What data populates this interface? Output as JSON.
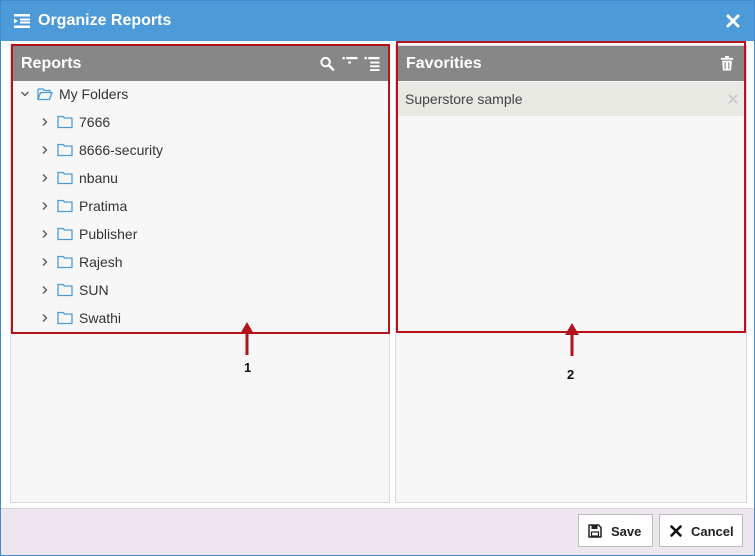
{
  "dialog": {
    "title": "Organize Reports",
    "title_icon": "list-icon",
    "close_icon": "close-icon",
    "accent_color": "#4c9ad8"
  },
  "reports_panel": {
    "title": "Reports",
    "header_icons": [
      "search-icon",
      "expand-all-icon",
      "collapse-all-icon"
    ],
    "root": {
      "label": "My Folders",
      "expanded": true
    },
    "folders": [
      "7666",
      "8666-security",
      "nbanu",
      "Pratima",
      "Publisher",
      "Rajesh",
      "SUN",
      "Swathi"
    ]
  },
  "favorites_panel": {
    "title": "Favorities",
    "header_icon": "trash-icon",
    "items": [
      "Superstore sample"
    ]
  },
  "annotations": {
    "left_number": "1",
    "right_number": "2",
    "color": "#b5121b"
  },
  "footer": {
    "save_label": "Save",
    "cancel_label": "Cancel"
  }
}
